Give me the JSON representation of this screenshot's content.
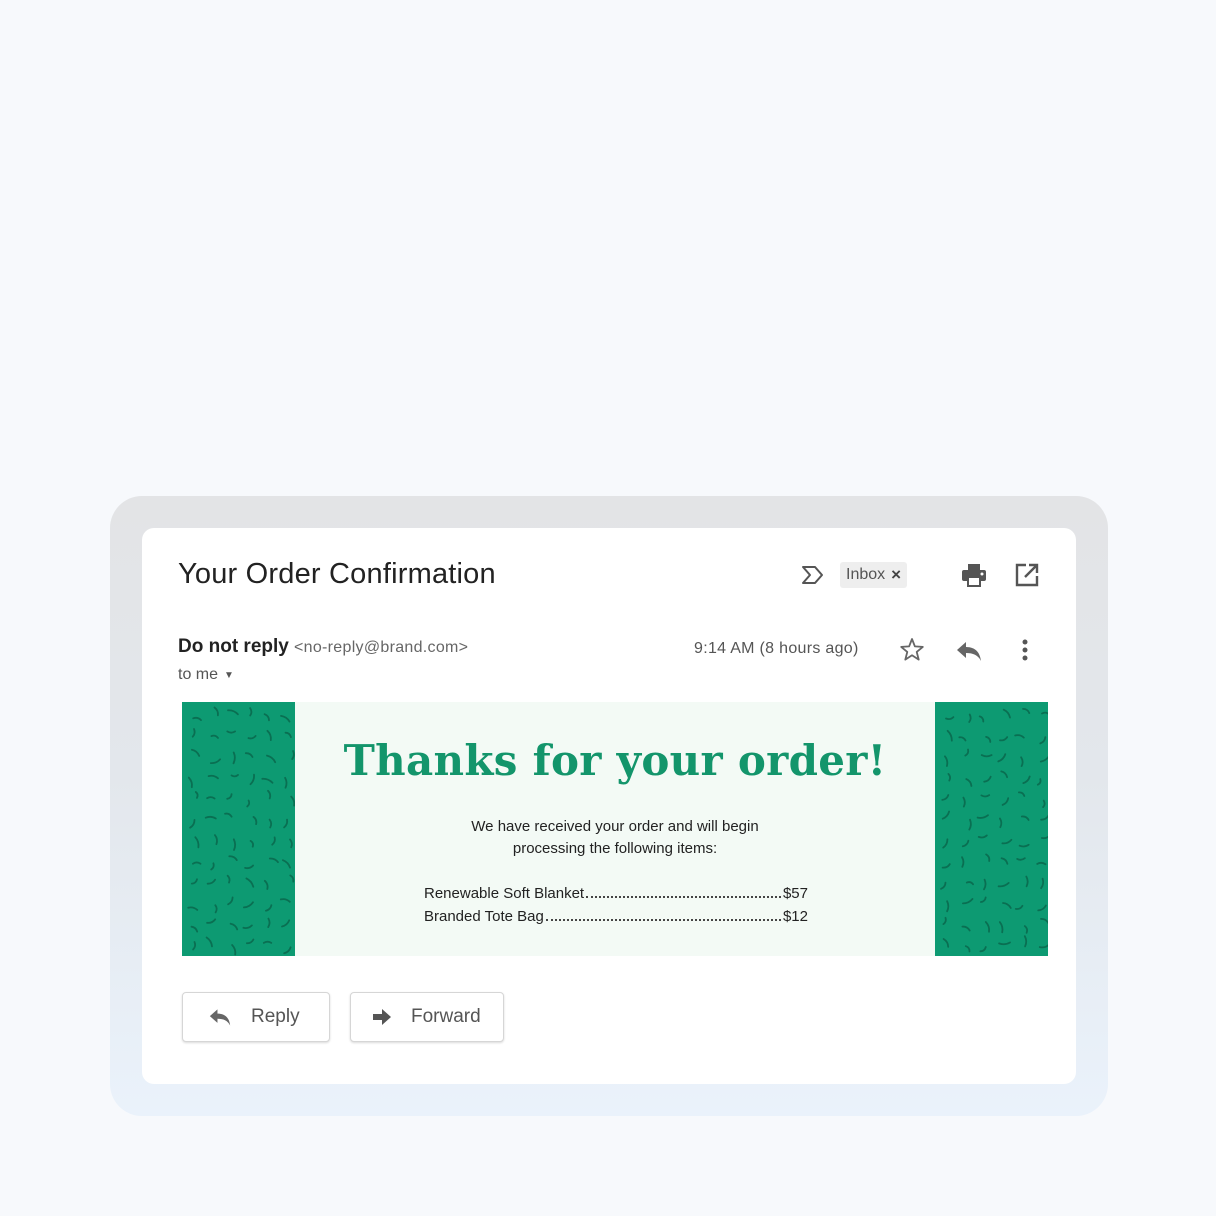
{
  "email": {
    "subject": "Your Order Confirmation",
    "label_chip": "Inbox",
    "label_chip_close": "×",
    "sender_name": "Do not reply",
    "sender_email": "<no-reply@brand.com>",
    "recipient": "to me",
    "timestamp": "9:14 AM (8 hours ago)"
  },
  "banner": {
    "headline": "Thanks for your order!",
    "intro_line1": "We have received your order and will begin",
    "intro_line2": "processing the following items:",
    "items": [
      {
        "name": "Renewable Soft Blanket",
        "price": "$57"
      },
      {
        "name": "Branded Tote Bag",
        "price": "$12"
      }
    ]
  },
  "actions": {
    "reply_label": "Reply",
    "forward_label": "Forward"
  },
  "icons": {
    "label": "label-icon",
    "print": "print-icon",
    "popout": "open-in-new-icon",
    "star": "star-icon",
    "reply": "reply-icon",
    "more": "more-vert-icon",
    "forward": "forward-arrow-icon"
  },
  "colors": {
    "brand_green": "#0d9a72",
    "headline_green": "#13956b",
    "banner_bg": "#f3faf5",
    "page_bg": "#f7f9fc"
  }
}
